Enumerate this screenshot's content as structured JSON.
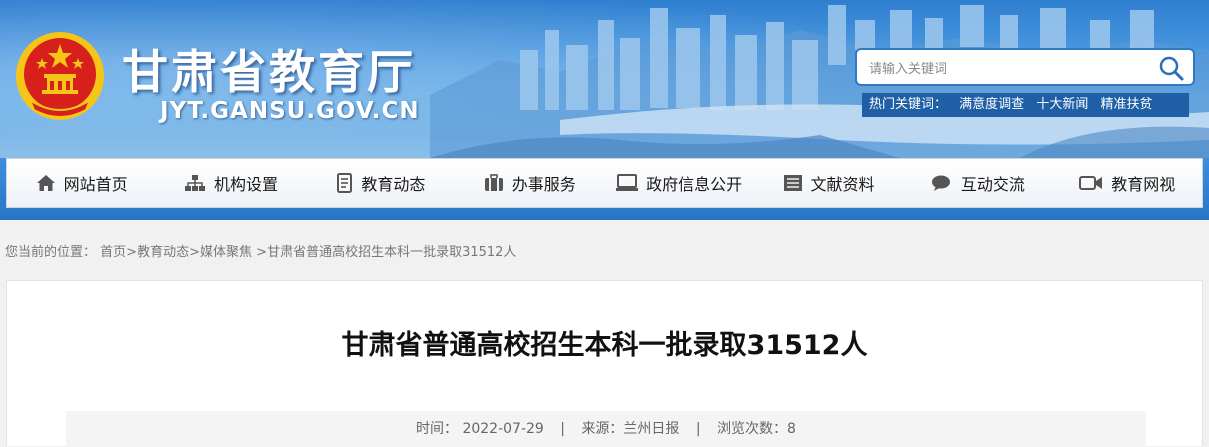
{
  "header": {
    "site_title": "甘肃省教育厅",
    "site_domain": "JYT.GANSU.GOV.CN",
    "search": {
      "placeholder": "请输入关键词"
    },
    "hot_keywords": {
      "label": "热门关键词：",
      "items": [
        "满意度调查",
        "十大新闻",
        "精准扶贫"
      ]
    }
  },
  "nav": {
    "items": [
      {
        "label": "网站首页",
        "icon": "home-icon"
      },
      {
        "label": "机构设置",
        "icon": "org-chart-icon"
      },
      {
        "label": "教育动态",
        "icon": "document-icon"
      },
      {
        "label": "办事服务",
        "icon": "briefcase-icon"
      },
      {
        "label": "政府信息公开",
        "icon": "monitor-icon"
      },
      {
        "label": "文献资料",
        "icon": "archive-icon"
      },
      {
        "label": "互动交流",
        "icon": "chat-icon"
      },
      {
        "label": "教育网视",
        "icon": "video-camera-icon"
      }
    ]
  },
  "breadcrumb": {
    "prefix": "您当前的位置：",
    "items": [
      "首页",
      "教育动态",
      "媒体聚焦"
    ],
    "current": "甘肃省普通高校招生本科一批录取31512人",
    "sep": ">"
  },
  "article": {
    "title": "甘肃省普通高校招生本科一批录取31512人",
    "meta": {
      "time": "时间： 2022-07-29",
      "source": "来源：兰州日报",
      "views": "浏览次数：8",
      "sep": "|"
    }
  },
  "colors": {
    "banner_blue": "#2f7fd0",
    "nav_bar_blue": "#2a74c6",
    "hot_bar_bg": "#1e5fa6",
    "emblem_red": "#d7201b",
    "emblem_gold": "#f5c518"
  }
}
